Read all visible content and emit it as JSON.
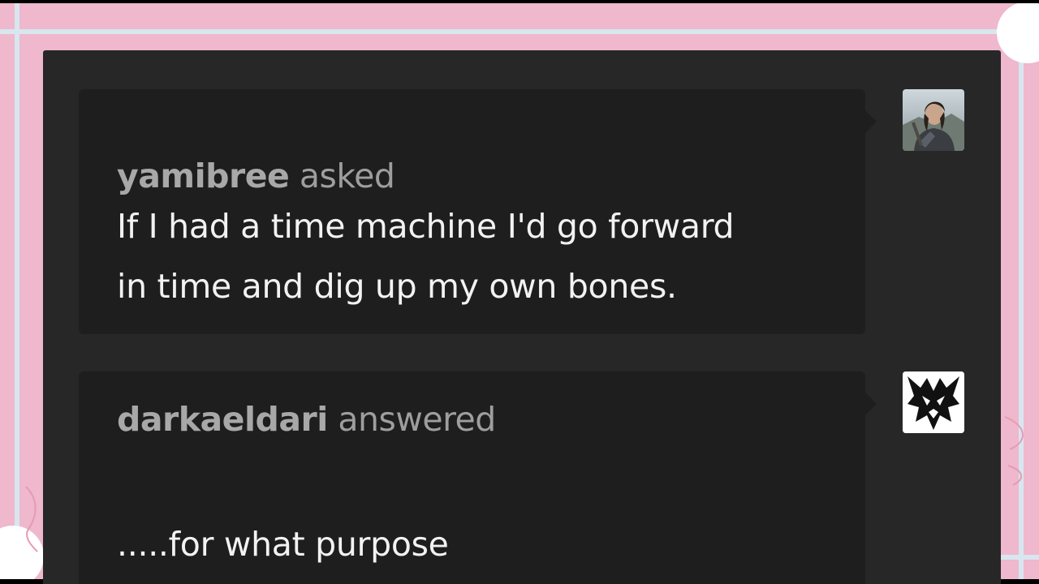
{
  "asker": {
    "username": "yamibree",
    "verb": "asked",
    "message_lines": [
      "If I had a time machine I'd go forward",
      "in time and dig up my own bones."
    ],
    "avatar_icon": "portrait-avatar-icon"
  },
  "answerer": {
    "username": "darkaeldari",
    "verb": "answered",
    "message_lines": [
      ".....for what purpose"
    ],
    "avatar_icon": "dragon-logo-avatar-icon"
  },
  "colors": {
    "background_pink": "#efb8cc",
    "panel_dark": "#272727",
    "card_dark": "#1e1e1e",
    "header_gray": "#9e9e9e",
    "body_white": "#f2f2f2"
  }
}
